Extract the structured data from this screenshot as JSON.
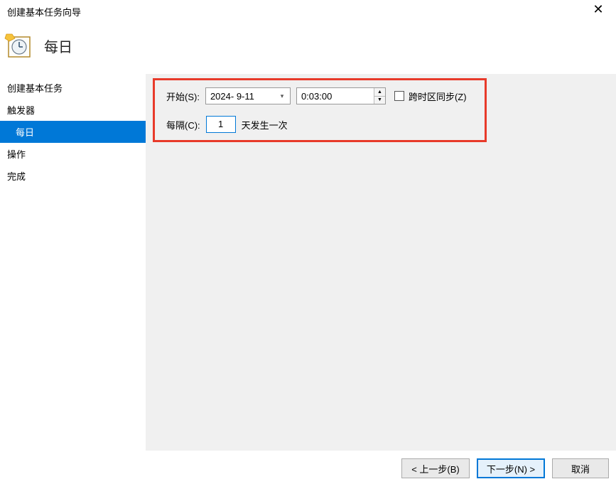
{
  "window": {
    "title": "创建基本任务向导"
  },
  "page": {
    "title": "每日"
  },
  "sidebar": {
    "items": [
      {
        "label": "创建基本任务"
      },
      {
        "label": "触发器"
      },
      {
        "label": "每日"
      },
      {
        "label": "操作"
      },
      {
        "label": "完成"
      }
    ],
    "selectedIndex": 2
  },
  "form": {
    "startLabel": "开始(S):",
    "dateValue": "2024- 9-11",
    "timeValue": "0:03:00",
    "syncTimezoneLabel": "跨时区同步(Z)",
    "syncTimezoneChecked": false,
    "intervalLabel": "每隔(C):",
    "intervalValue": "1",
    "intervalSuffix": "天发生一次"
  },
  "buttons": {
    "back": "< 上一步(B)",
    "next": "下一步(N) >",
    "cancel": "取消"
  }
}
